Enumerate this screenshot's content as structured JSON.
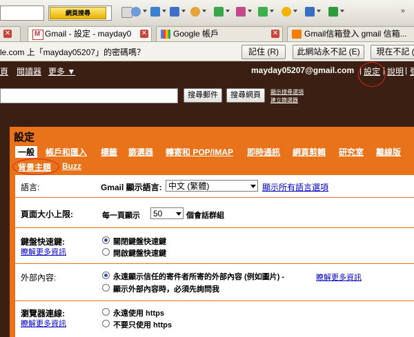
{
  "browser": {
    "search_button": "網頁搜尋",
    "tabs": [
      {
        "label": "Gmail - 設定 - mayday0"
      },
      {
        "label": "Google 帳戶"
      },
      {
        "label": "Gmail信箱登入 gmail 信箱..."
      }
    ],
    "colors": {
      "accent_tab_close": "#c9453a"
    }
  },
  "password_bar": {
    "prompt": "le.com 上「mayday05207」的密碼嗎？",
    "buttons": [
      "記住 (R)",
      "此網站永不記 (E)",
      "現在不記 ("
    ]
  },
  "gmail": {
    "top_left_links": [
      "頁",
      "閱讀器",
      "更多 ▼"
    ],
    "email": "mayday05207@gmail.com",
    "top_right_links": [
      "設定",
      "說明",
      "登"
    ],
    "search_mail_button": "搜尋郵件",
    "search_web_button": "搜尋網頁",
    "search_options_link": "顯示搜尋選項",
    "create_filter_link": "建立篩選器",
    "colors": {
      "header_bg": "#3b1f12",
      "settings_accent": "#e8731a",
      "link_blue": "#0000cc"
    }
  },
  "settings": {
    "title": "設定",
    "nav": [
      "一般",
      "帳戶和匯入",
      "標籤",
      "篩選器",
      "轉寄和 POP/IMAP",
      "即時通訊",
      "網頁剪輯",
      "研究室",
      "離線版",
      "背景主題",
      "Buzz"
    ],
    "language": {
      "label": "語言:",
      "prefix": "Gmail 顯示語言:",
      "value": "中文 (繁體)",
      "link": "顯示所有語言選項"
    },
    "page_size": {
      "label": "頁面大小上限:",
      "prefix": "每一頁顯示",
      "value": "50",
      "suffix": "個會話群組"
    },
    "shortcuts": {
      "label": "鍵盤快速鍵:",
      "learn_more": "瞭解更多資訊",
      "options": [
        "關閉鍵盤快速鍵",
        "開啟鍵盤快速鍵"
      ],
      "selected": 0
    },
    "external_content": {
      "label": "外部內容:",
      "options": [
        "永遠顯示信任的寄件者所寄的外部內容 (例如圖片) -",
        "顯示外部內容時，必須先詢問我"
      ],
      "learn_more": "瞭解更多資訊",
      "selected": 0
    },
    "browser_connection": {
      "label": "瀏覽器連線:",
      "learn_more": "瞭解更多資訊",
      "options": [
        "永遠使用 https",
        "不要只使用 https"
      ],
      "selected": 0
    }
  }
}
